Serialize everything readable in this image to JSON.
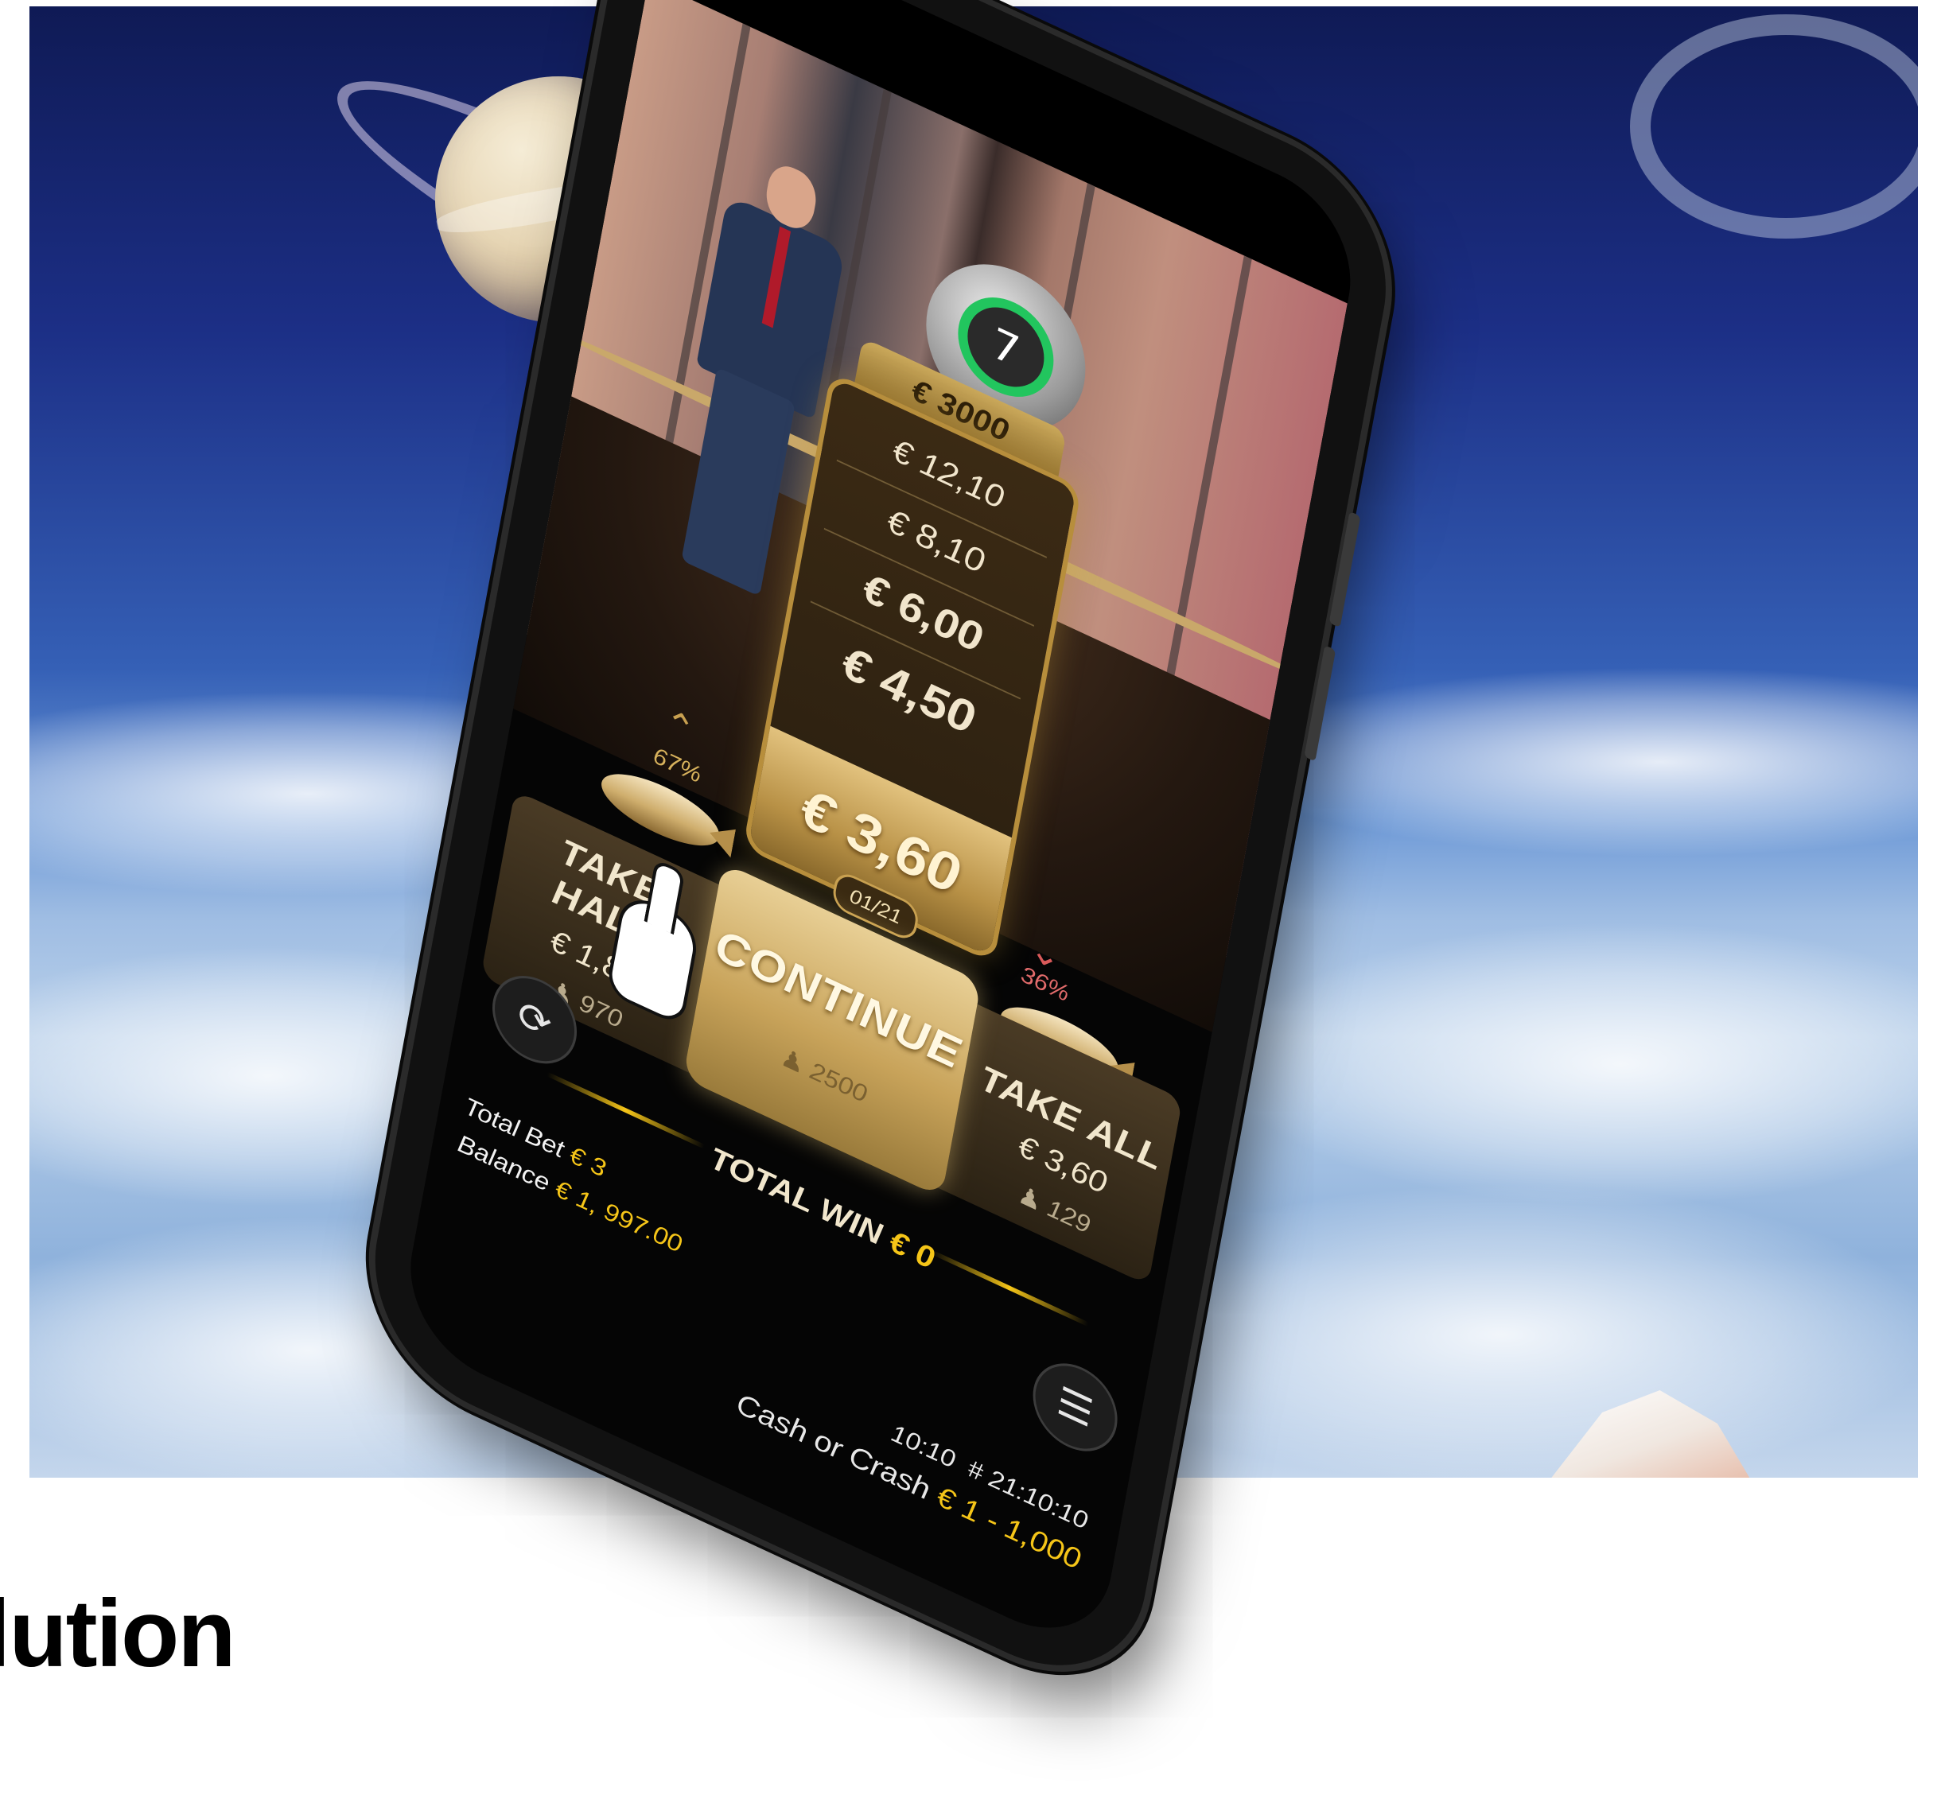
{
  "game": {
    "timer": "7",
    "top_prize": "€ 3000",
    "ladder": [
      "€ 12,10",
      "€ 8,10",
      "€ 6,00",
      "€ 4,50"
    ],
    "current_prize": "€ 3,60",
    "round": "01/21",
    "left_probability": "67%",
    "right_probability": "36%"
  },
  "decision": {
    "take_half": {
      "label": "TAKE HALF",
      "amount": "€ 1,80",
      "players": "970"
    },
    "continue": {
      "label": "CONTINUE",
      "players": "2500"
    },
    "take_all": {
      "label": "TAKE ALL",
      "amount": "€ 3,60",
      "players": "129"
    }
  },
  "totals": {
    "total_win_label": "TOTAL WIN",
    "total_win_value": "€ 0",
    "total_bet_label": "Total Bet",
    "total_bet_value": "€ 3",
    "balance_label": "Balance",
    "balance_value": "€ 1, 997.00"
  },
  "footer": {
    "time": "10:10",
    "round_id": "# 21:10:10",
    "game_name": "Cash or Crash",
    "limits": "€ 1 - 1,000"
  },
  "icons": {
    "refresh": "refresh-icon",
    "menu": "hamburger-menu-icon",
    "player": "person-icon"
  },
  "colors": {
    "accent_gold": "#f5c518",
    "timer_green": "#22c55e",
    "ladder_gold": "#b78e3c"
  },
  "brand": {
    "text": "lution"
  }
}
